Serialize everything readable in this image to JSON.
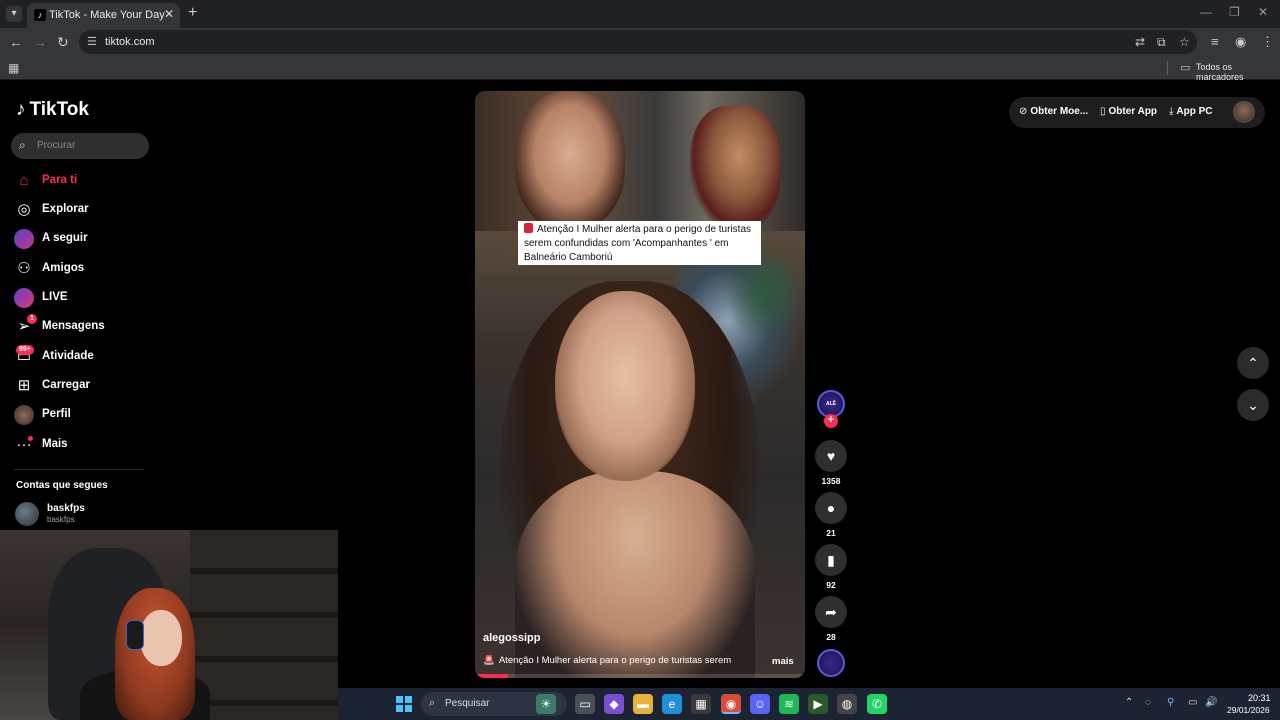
{
  "browser": {
    "tab_title": "TikTok - Make Your Day",
    "url": "tiktok.com",
    "bookmarks_label": "Todos os marcadores"
  },
  "sidebar": {
    "logo": "TikTok",
    "search_placeholder": "Procurar",
    "items": [
      {
        "label": "Para ti",
        "icon": "home-icon",
        "active": true
      },
      {
        "label": "Explorar",
        "icon": "compass-icon"
      },
      {
        "label": "A seguir",
        "icon": "avatar-icon"
      },
      {
        "label": "Amigos",
        "icon": "users-icon"
      },
      {
        "label": "LIVE",
        "icon": "live-icon"
      },
      {
        "label": "Mensagens",
        "icon": "send-icon",
        "badge": "1"
      },
      {
        "label": "Atividade",
        "icon": "inbox-icon",
        "badge": "99+"
      },
      {
        "label": "Carregar",
        "icon": "upload-icon"
      },
      {
        "label": "Perfil",
        "icon": "profile-icon"
      },
      {
        "label": "Mais",
        "icon": "more-icon"
      }
    ],
    "following_title": "Contas que segues",
    "following": [
      {
        "name": "baskfps",
        "handle": "baskfps"
      }
    ]
  },
  "top_actions": {
    "coins": "Obter Moe...",
    "app": "Obter App",
    "pc": "App PC"
  },
  "video": {
    "caption_overlay": "Atenção I Mulher alerta para o perigo de turistas serem confundidas com 'Acompanhantes ' em Balneário Camboriú",
    "author": "alegossipp",
    "description": "Atenção I Mulher alerta para o perigo de turistas serem",
    "more": "mais",
    "progress": 0.1
  },
  "actions": {
    "likes": "1358",
    "comments": "21",
    "saves": "92",
    "shares": "28"
  },
  "taskbar": {
    "search": "Pesquisar",
    "time": "20:31",
    "date": "29/01/2026"
  },
  "colors": {
    "accent": "#fe2c55",
    "background": "#000000"
  }
}
